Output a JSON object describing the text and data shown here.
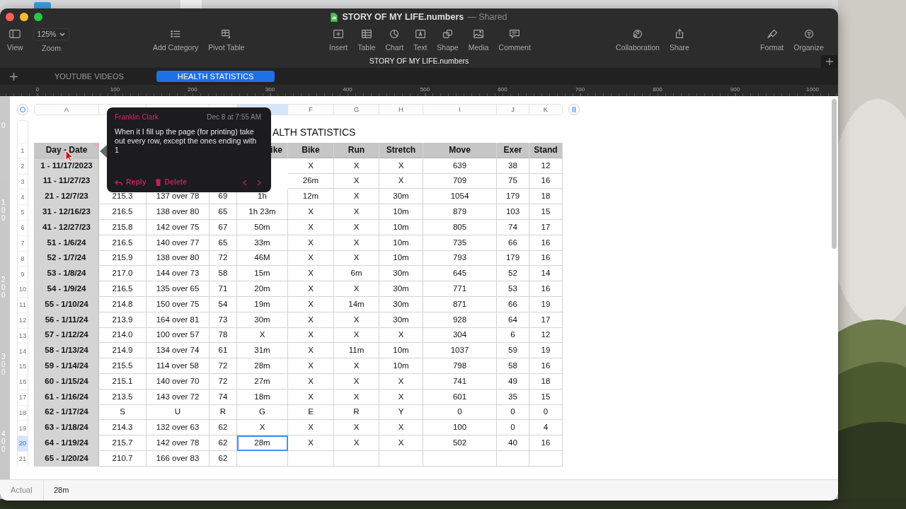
{
  "window": {
    "title": "STORY OF MY LIFE.numbers",
    "title_suffix": "— Shared"
  },
  "toolbar": [
    {
      "items": [
        {
          "label": "View"
        },
        {
          "label": "Zoom",
          "value": "125%"
        }
      ]
    },
    {
      "items": [
        {
          "label": "Add Category"
        },
        {
          "label": "Pivot Table"
        }
      ]
    },
    {
      "items": [
        {
          "label": "Insert"
        },
        {
          "label": "Table"
        },
        {
          "label": "Chart"
        },
        {
          "label": "Text"
        },
        {
          "label": "Shape"
        },
        {
          "label": "Media"
        },
        {
          "label": "Comment"
        }
      ]
    },
    {
      "items": [
        {
          "label": "Collaboration"
        },
        {
          "label": "Share"
        }
      ]
    },
    {
      "items": [
        {
          "label": "Format"
        },
        {
          "label": "Organize"
        }
      ]
    }
  ],
  "document_title": "STORY OF MY LIFE.numbers",
  "sheet_tabs": [
    {
      "label": "YOUTUBE VIDEOS",
      "selected": false
    },
    {
      "label": "HEALTH STATISTICS",
      "selected": true
    }
  ],
  "ruler": {
    "marks": [
      "0",
      "100",
      "200",
      "300",
      "400",
      "500",
      "600",
      "700",
      "800",
      "900",
      "1000"
    ]
  },
  "vertical_ruler": {
    "marks": [
      "0",
      "100",
      "200",
      "300",
      "400"
    ]
  },
  "column_letters": [
    {
      "letter": "A",
      "selected": false
    },
    {
      "selected": false
    },
    {
      "selected": false
    },
    {
      "selected": false
    },
    {
      "selected": true
    },
    {
      "letter": "F",
      "selected": false
    },
    {
      "letter": "G",
      "selected": false
    },
    {
      "letter": "H",
      "selected": false
    },
    {
      "letter": "I",
      "selected": false
    },
    {
      "letter": "J",
      "selected": false
    },
    {
      "letter": "K",
      "selected": false
    }
  ],
  "table": {
    "title": "ALTH STATISTICS",
    "header": {
      "number": "1",
      "cells": [
        {
          "text": "Day - Date",
          "comment": true
        },
        null,
        null,
        null,
        {
          "text": "ike",
          "covered": true
        },
        {
          "text": "Bike"
        },
        {
          "text": "Run"
        },
        {
          "text": "Stretch"
        },
        {
          "text": "Move"
        },
        {
          "text": "Exer"
        },
        {
          "text": "Stand"
        }
      ]
    },
    "rows": [
      {
        "number": "2",
        "selected": false,
        "cells": [
          "1 - 11/17/2023",
          null,
          null,
          null,
          null,
          "X",
          "X",
          "X",
          "639",
          "38",
          "12"
        ]
      },
      {
        "number": "3",
        "selected": false,
        "cells": [
          "11 - 11/27/23",
          null,
          null,
          null,
          null,
          "26m",
          "X",
          "X",
          "709",
          "75",
          "16"
        ]
      },
      {
        "number": "4",
        "selected": false,
        "cells": [
          "21 - 12/7/23",
          "215.3",
          "137 over 78",
          "69",
          "1h",
          "12m",
          "X",
          "30m",
          "1054",
          "179",
          "18"
        ]
      },
      {
        "number": "5",
        "selected": false,
        "cells": [
          "31 - 12/16/23",
          "216.5",
          "138 over 80",
          "65",
          "1h 23m",
          "X",
          "X",
          "10m",
          "879",
          "103",
          "15"
        ]
      },
      {
        "number": "6",
        "selected": false,
        "cells": [
          "41 - 12/27/23",
          "215.8",
          "142 over 75",
          "67",
          "50m",
          "X",
          "X",
          "10m",
          "805",
          "74",
          "17"
        ]
      },
      {
        "number": "7",
        "selected": false,
        "cells": [
          "51 - 1/6/24",
          "216.5",
          "140 over 77",
          "65",
          "33m",
          "X",
          "X",
          "10m",
          "735",
          "66",
          "16"
        ]
      },
      {
        "number": "8",
        "selected": false,
        "cells": [
          "52 - 1/7/24",
          "215.9",
          "138 over 80",
          "72",
          "46M",
          "X",
          "X",
          "10m",
          "793",
          "179",
          "16"
        ]
      },
      {
        "number": "9",
        "selected": false,
        "cells": [
          "53 - 1/8/24",
          "217.0",
          "144 over 73",
          "58",
          "15m",
          "X",
          "6m",
          "30m",
          "645",
          "52",
          "14"
        ]
      },
      {
        "number": "10",
        "selected": false,
        "cells": [
          "54 - 1/9/24",
          "216.5",
          "135 over 65",
          "71",
          "20m",
          "X",
          "X",
          "30m",
          "771",
          "53",
          "16"
        ]
      },
      {
        "number": "11",
        "selected": false,
        "cells": [
          "55 - 1/10/24",
          "214.8",
          "150 over 75",
          "54",
          "19m",
          "X",
          "14m",
          "30m",
          "871",
          "66",
          "19"
        ]
      },
      {
        "number": "12",
        "selected": false,
        "cells": [
          "56 - 1/11/24",
          "213.9",
          "164 over 81",
          "73",
          "30m",
          "X",
          "X",
          "30m",
          "928",
          "64",
          "17"
        ]
      },
      {
        "number": "13",
        "selected": false,
        "cells": [
          "57 - 1/12/24",
          "214.0",
          "100 over 57",
          "78",
          "X",
          "X",
          "X",
          "X",
          "304",
          "6",
          "12"
        ]
      },
      {
        "number": "14",
        "selected": false,
        "cells": [
          "58 - 1/13/24",
          "214.9",
          "134 over 74",
          "61",
          "31m",
          "X",
          "11m",
          "10m",
          "1037",
          "59",
          "19"
        ]
      },
      {
        "number": "15",
        "selected": false,
        "cells": [
          "59 - 1/14/24",
          "215.5",
          "114 over 58",
          "72",
          "28m",
          "X",
          "X",
          "10m",
          "798",
          "58",
          "16"
        ]
      },
      {
        "number": "16",
        "selected": false,
        "cells": [
          "60 - 1/15/24",
          "215.1",
          "140 over 70",
          "72",
          "27m",
          "X",
          "X",
          "X",
          "741",
          "49",
          "18"
        ]
      },
      {
        "number": "17",
        "selected": false,
        "cells": [
          "61 - 1/16/24",
          "213.5",
          "143 over 72",
          "74",
          "18m",
          "X",
          "X",
          "X",
          "601",
          "35",
          "15"
        ]
      },
      {
        "number": "18",
        "selected": false,
        "cells": [
          "62 - 1/17/24",
          "S",
          "U",
          "R",
          "G",
          "E",
          "R",
          "Y",
          "0",
          "0",
          "0"
        ]
      },
      {
        "number": "19",
        "selected": false,
        "cells": [
          "63 - 1/18/24",
          "214.3",
          "132 over 63",
          "62",
          "X",
          "X",
          "X",
          "X",
          "100",
          "0",
          "4"
        ]
      },
      {
        "number": "20",
        "selected": true,
        "cells": [
          "64 - 1/19/24",
          "215.7",
          "142 over 78",
          "62",
          {
            "text": "28m",
            "selected": true
          },
          "X",
          "X",
          "X",
          "502",
          "40",
          "16"
        ]
      },
      {
        "number": "21",
        "selected": false,
        "cells": [
          "65 - 1/20/24",
          "210.7",
          "166 over 83",
          "62",
          null,
          null,
          null,
          null,
          null,
          null,
          null
        ]
      }
    ]
  },
  "comment": {
    "author": "Franklin Clark",
    "date": "Dec 8 at 7:55 AM",
    "text": "When it I fill up the page (for printing) take out every row, except the ones ending with 1",
    "reply": "Reply",
    "delete": "Delete"
  },
  "status_bar": {
    "label": "Actual",
    "value": "28m"
  }
}
